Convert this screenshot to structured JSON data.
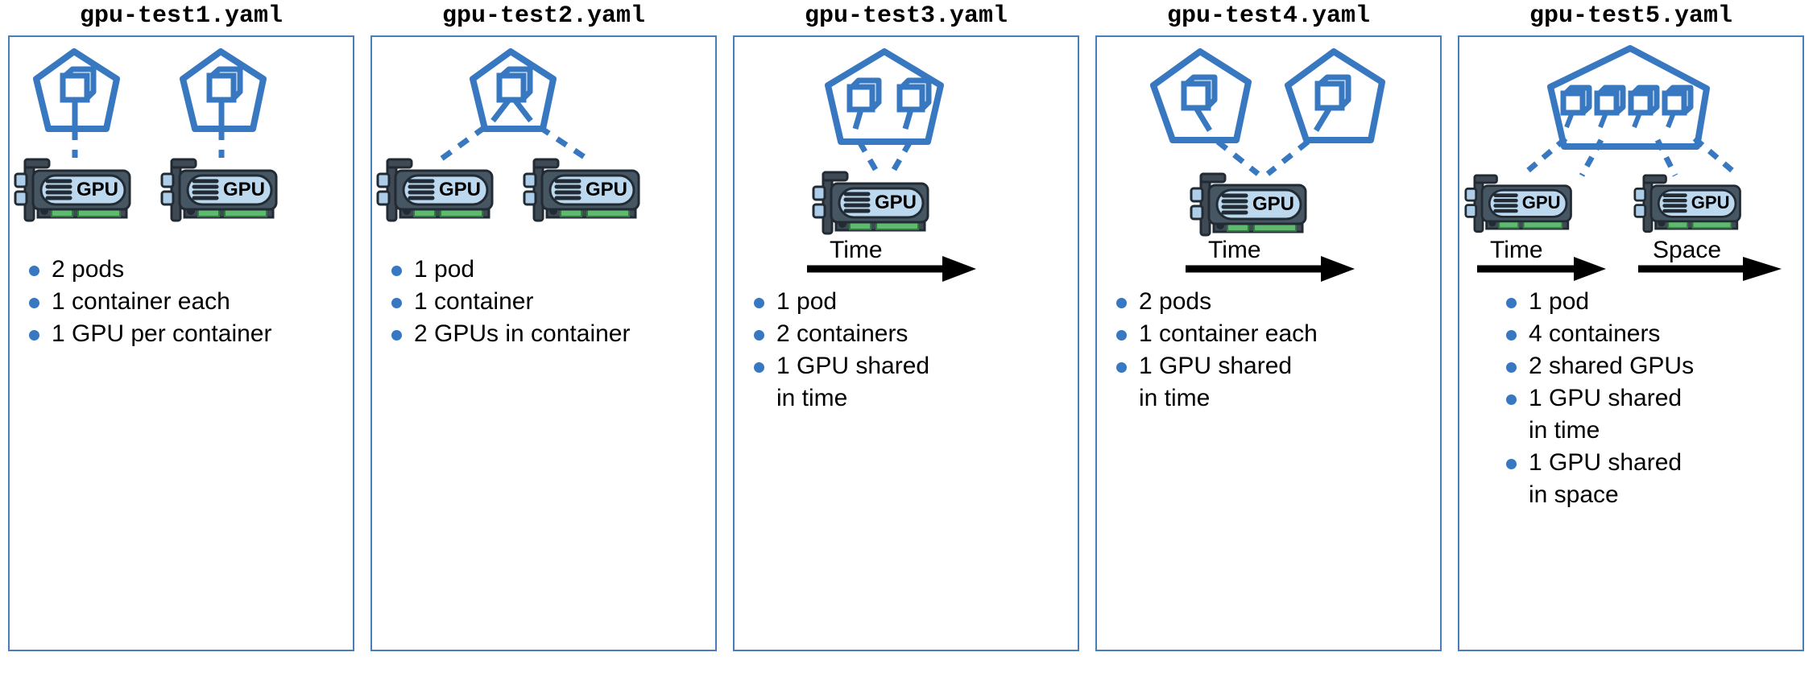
{
  "diagram": {
    "accent_blue": "#3878c0",
    "panel_border": "#4a7ebb",
    "gpu_label": "GPU",
    "panels": [
      {
        "title": "gpu-test1.yaml",
        "layout": "two-pods-two-gpus",
        "pods": 2,
        "containers_per_pod": 1,
        "gpus": 2,
        "arrows": [],
        "bullets": [
          {
            "text": "2 pods",
            "continuation": false
          },
          {
            "text": "1 container each",
            "continuation": false
          },
          {
            "text": "1 GPU per container",
            "continuation": false
          }
        ]
      },
      {
        "title": "gpu-test2.yaml",
        "layout": "one-pod-two-gpus",
        "pods": 1,
        "containers_per_pod": 1,
        "gpus": 2,
        "arrows": [],
        "bullets": [
          {
            "text": "1 pod",
            "continuation": false
          },
          {
            "text": "1 container",
            "continuation": false
          },
          {
            "text": "2 GPUs in container",
            "continuation": false
          }
        ]
      },
      {
        "title": "gpu-test3.yaml",
        "layout": "one-pod-two-containers-one-gpu",
        "pods": 1,
        "containers_per_pod": 2,
        "gpus": 1,
        "arrows": [
          {
            "label": "Time"
          }
        ],
        "bullets": [
          {
            "text": "1 pod",
            "continuation": false
          },
          {
            "text": "2 containers",
            "continuation": false
          },
          {
            "text": "1 GPU shared",
            "continuation": false
          },
          {
            "text": "in time",
            "continuation": true
          }
        ]
      },
      {
        "title": "gpu-test4.yaml",
        "layout": "two-pods-one-gpu",
        "pods": 2,
        "containers_per_pod": 1,
        "gpus": 1,
        "arrows": [
          {
            "label": "Time"
          }
        ],
        "bullets": [
          {
            "text": "2 pods",
            "continuation": false
          },
          {
            "text": "1 container each",
            "continuation": false
          },
          {
            "text": "1 GPU shared",
            "continuation": false
          },
          {
            "text": "in time",
            "continuation": true
          }
        ]
      },
      {
        "title": "gpu-test5.yaml",
        "layout": "one-pod-four-containers-two-gpus",
        "pods": 1,
        "containers_per_pod": 4,
        "gpus": 2,
        "arrows": [
          {
            "label": "Time"
          },
          {
            "label": "Space"
          }
        ],
        "bullets": [
          {
            "text": "1 pod",
            "continuation": false
          },
          {
            "text": "4 containers",
            "continuation": false
          },
          {
            "text": "2 shared GPUs",
            "continuation": false
          },
          {
            "text": "1 GPU shared",
            "continuation": false
          },
          {
            "text": "in time",
            "continuation": true
          },
          {
            "text": "1 GPU shared",
            "continuation": false
          },
          {
            "text": "in space",
            "continuation": true
          }
        ]
      }
    ]
  }
}
